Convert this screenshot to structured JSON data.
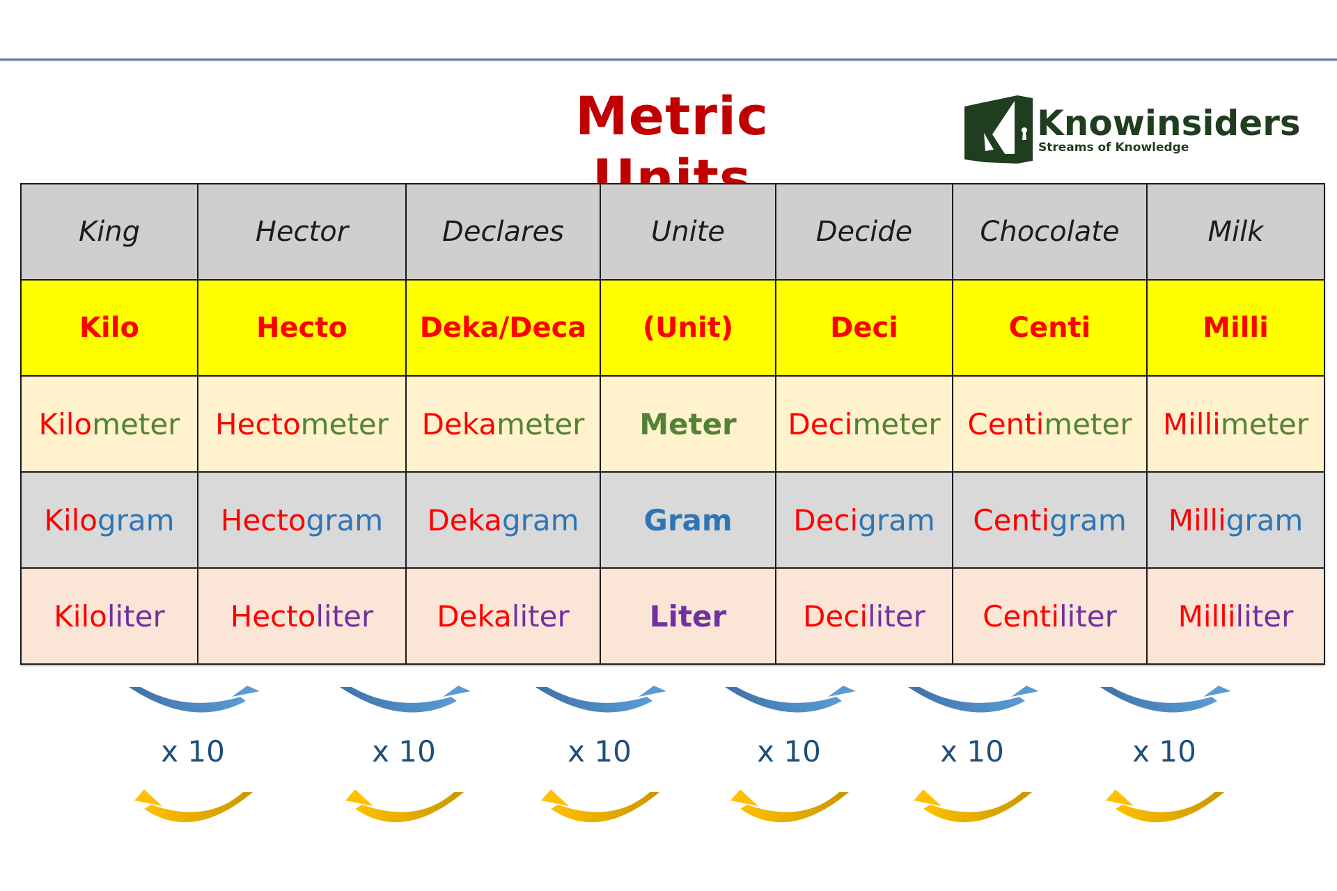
{
  "page": {
    "title": "Metric Units",
    "title_color": "#c00000"
  },
  "logo": {
    "name": "Knowinsiders",
    "tagline": "Streams of Knowledge",
    "color": "#1f3d1f"
  },
  "table": {
    "mnemonic_row": [
      "King",
      "Hector",
      "Declares",
      "Unite",
      "Decide",
      "Chocolate",
      "Milk"
    ],
    "prefix_row": [
      "Kilo",
      "Hecto",
      "Deka/Deca",
      "(Unit)",
      "Deci",
      "Centi",
      "Milli"
    ],
    "meter_row": [
      {
        "prefix": "Kilo",
        "base": "meter"
      },
      {
        "prefix": "Hecto",
        "base": "meter"
      },
      {
        "prefix": "Deka",
        "base": "meter"
      },
      {
        "prefix": "",
        "base": "Meter"
      },
      {
        "prefix": "Deci",
        "base": "meter"
      },
      {
        "prefix": "Centi",
        "base": "meter"
      },
      {
        "prefix": "Milli",
        "base": "meter"
      }
    ],
    "gram_row": [
      {
        "prefix": "Kilo",
        "base": "gram"
      },
      {
        "prefix": "Hecto",
        "base": "gram"
      },
      {
        "prefix": "Deka",
        "base": "gram"
      },
      {
        "prefix": "",
        "base": "Gram"
      },
      {
        "prefix": "Deci",
        "base": "gram"
      },
      {
        "prefix": "Centi",
        "base": "gram"
      },
      {
        "prefix": "Milli",
        "base": "gram"
      }
    ],
    "liter_row": [
      {
        "prefix": "Kilo",
        "base": "liter"
      },
      {
        "prefix": "Hecto",
        "base": "liter"
      },
      {
        "prefix": "Deka",
        "base": "liter"
      },
      {
        "prefix": "",
        "base": "Liter"
      },
      {
        "prefix": "Deci",
        "base": "liter"
      },
      {
        "prefix": "Centi",
        "base": "liter"
      },
      {
        "prefix": "Milli",
        "base": "liter"
      }
    ],
    "colors": {
      "mnemonic_bg": "#d0cece",
      "prefix_bg": "#ffff00",
      "prefix_text": "#ff0000",
      "meter_bg": "#fff2cc",
      "meter_text": "#548235",
      "gram_bg": "#d9d9d9",
      "gram_text": "#2e75b6",
      "liter_bg": "#fbe5d6",
      "liter_text": "#7030a0"
    }
  },
  "conversions": {
    "factor_labels": [
      "x 10",
      "x 10",
      "x 10",
      "x 10",
      "x 10",
      "x 10"
    ],
    "upper_arrow_icon": "curved-arrow-right-icon",
    "lower_arrow_icon": "curved-arrow-left-icon",
    "upper_arrow_color": "#4a7fb5",
    "lower_arrow_color": "#e6ac00"
  }
}
